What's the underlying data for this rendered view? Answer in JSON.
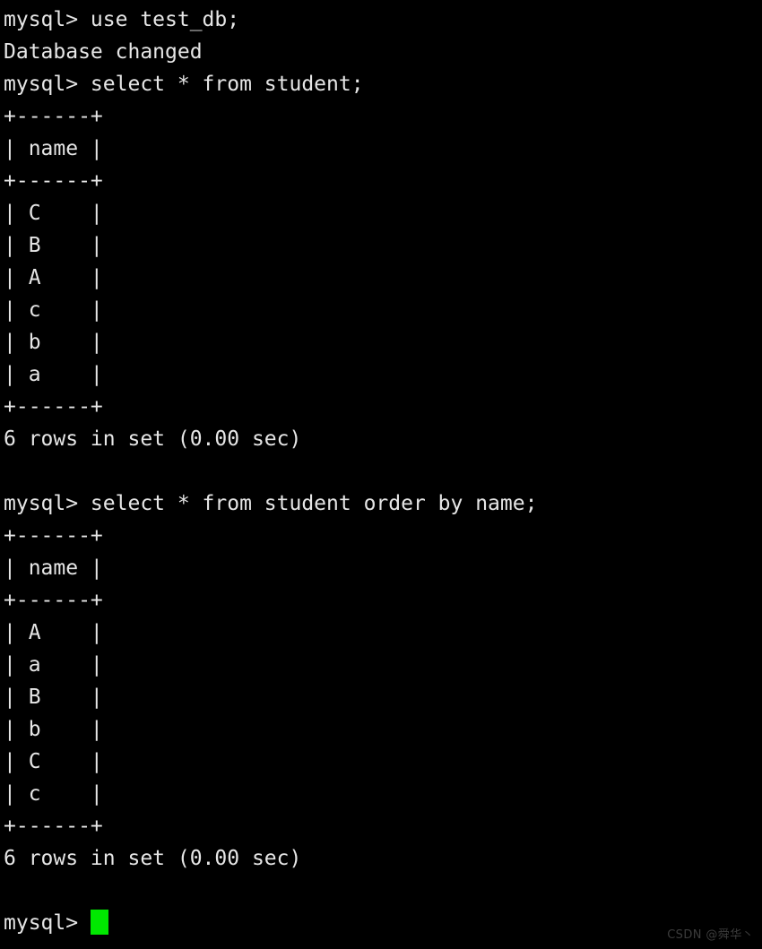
{
  "terminal": {
    "app": "mysql-client",
    "background_color": "#000000",
    "text_color": "#e6e6e6",
    "cursor_color": "#00e800",
    "watermark_color": "#3c3c3c",
    "lines": [
      "mysql> use test_db;",
      "Database changed",
      "mysql> select * from student;",
      "+------+",
      "| name |",
      "+------+",
      "| C    |",
      "| B    |",
      "| A    |",
      "| c    |",
      "| b    |",
      "| a    |",
      "+------+",
      "6 rows in set (0.00 sec)",
      "",
      "mysql> select * from student order by name;",
      "+------+",
      "| name |",
      "+------+",
      "| A    |",
      "| a    |",
      "| B    |",
      "| b    |",
      "| C    |",
      "| c    |",
      "+------+",
      "6 rows in set (0.00 sec)",
      ""
    ],
    "final_prompt": "mysql> ",
    "commands": [
      "use test_db;",
      "select * from student;",
      "select * from student order by name;"
    ],
    "results": {
      "use_db_message": "Database changed",
      "unordered_query": {
        "column": "name",
        "rows": [
          "C",
          "B",
          "A",
          "c",
          "b",
          "a"
        ],
        "status": "6 rows in set (0.00 sec)"
      },
      "ordered_query": {
        "column": "name",
        "rows": [
          "A",
          "a",
          "B",
          "b",
          "C",
          "c"
        ],
        "status": "6 rows in set (0.00 sec)"
      }
    }
  },
  "watermark": {
    "text": "CSDN @舜华丶"
  }
}
